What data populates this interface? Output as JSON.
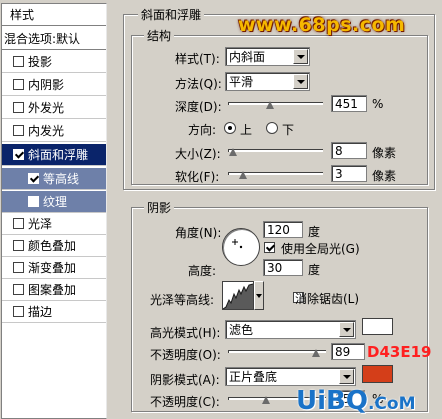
{
  "style_list": {
    "header": "样式",
    "blend_options": "混合选项:默认",
    "items": [
      {
        "label": "投影",
        "checked": false
      },
      {
        "label": "内阴影",
        "checked": false
      },
      {
        "label": "外发光",
        "checked": false
      },
      {
        "label": "内发光",
        "checked": false
      },
      {
        "label": "斜面和浮雕",
        "checked": true
      },
      {
        "label": "等高线",
        "checked": true
      },
      {
        "label": "纹理",
        "checked": false
      },
      {
        "label": "光泽",
        "checked": false
      },
      {
        "label": "颜色叠加",
        "checked": false
      },
      {
        "label": "渐变叠加",
        "checked": false
      },
      {
        "label": "图案叠加",
        "checked": false
      },
      {
        "label": "描边",
        "checked": false
      }
    ]
  },
  "bevel": {
    "section_title": "斜面和浮雕",
    "structure_title": "结构",
    "style_label": "样式(T):",
    "style_value": "内斜面",
    "technique_label": "方法(Q):",
    "technique_value": "平滑",
    "depth_label": "深度(D):",
    "depth_value": "451",
    "depth_unit": "%",
    "direction_label": "方向:",
    "dir_up": "上",
    "dir_down": "下",
    "size_label": "大小(Z):",
    "size_value": "8",
    "size_unit": "像素",
    "soften_label": "软化(F):",
    "soften_value": "3",
    "soften_unit": "像素"
  },
  "shading": {
    "title": "阴影",
    "angle_label": "角度(N):",
    "angle_value": "120",
    "angle_unit": "度",
    "global_light_label": "使用全局光(G)",
    "global_light_checked": true,
    "altitude_label": "高度:",
    "altitude_value": "30",
    "altitude_unit": "度",
    "gloss_contour_label": "光泽等高线:",
    "antialias_label": "消除锯齿(L)",
    "highlight_mode_label": "高光模式(H):",
    "highlight_mode_value": "滤色",
    "highlight_color": "#ffffff",
    "highlight_opacity_label": "不透明度(O):",
    "highlight_opacity_value": "89",
    "shadow_mode_label": "阴影模式(A):",
    "shadow_mode_value": "正片叠底",
    "shadow_color": "#d43e19",
    "shadow_opacity_label": "不透明度(C):",
    "shadow_opacity_value": "35",
    "opacity_unit": "%"
  },
  "annotations": {
    "shadow_hex": "D43E19",
    "watermark_top": "www.68ps.com",
    "watermark_bottom_main": "UiBQ",
    "watermark_bottom_domain": ".CoM"
  },
  "colors": {
    "selected_row": "#0a246a",
    "sub_row": "#6e80a9",
    "panel_bg": "#d4d0c8"
  }
}
